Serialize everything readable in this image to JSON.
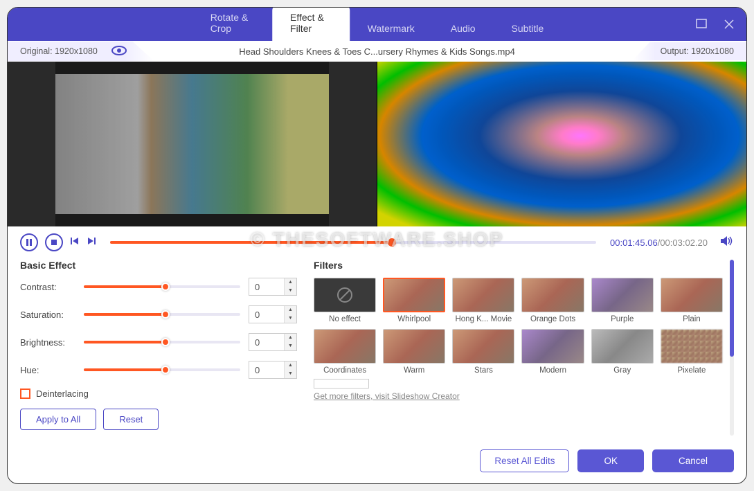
{
  "tabs": [
    "Rotate & Crop",
    "Effect & Filter",
    "Watermark",
    "Audio",
    "Subtitle"
  ],
  "activeTab": 1,
  "original": "Original: 1920x1080",
  "output": "Output: 1920x1080",
  "fileTitle": "Head Shoulders Knees & Toes  C...ursery Rhymes & Kids Songs.mp4",
  "time": {
    "current": "00:01:45.06",
    "total": "/00:03:02.20"
  },
  "basic": {
    "title": "Basic Effect",
    "sliders": [
      {
        "label": "Contrast:",
        "value": "0"
      },
      {
        "label": "Saturation:",
        "value": "0"
      },
      {
        "label": "Brightness:",
        "value": "0"
      },
      {
        "label": "Hue:",
        "value": "0"
      }
    ],
    "deinterlacing": "Deinterlacing",
    "applyAll": "Apply to All",
    "reset": "Reset"
  },
  "filters": {
    "title": "Filters",
    "items": [
      "No effect",
      "Whirlpool",
      "Hong K... Movie",
      "Orange Dots",
      "Purple",
      "Plain",
      "Coordinates",
      "Warm",
      "Stars",
      "Modern",
      "Gray",
      "Pixelate"
    ],
    "selected": 1,
    "more": "Get more filters, visit Slideshow Creator"
  },
  "footer": {
    "resetAll": "Reset All Edits",
    "ok": "OK",
    "cancel": "Cancel"
  },
  "watermark": "© THESOFTWARE.SHOP"
}
